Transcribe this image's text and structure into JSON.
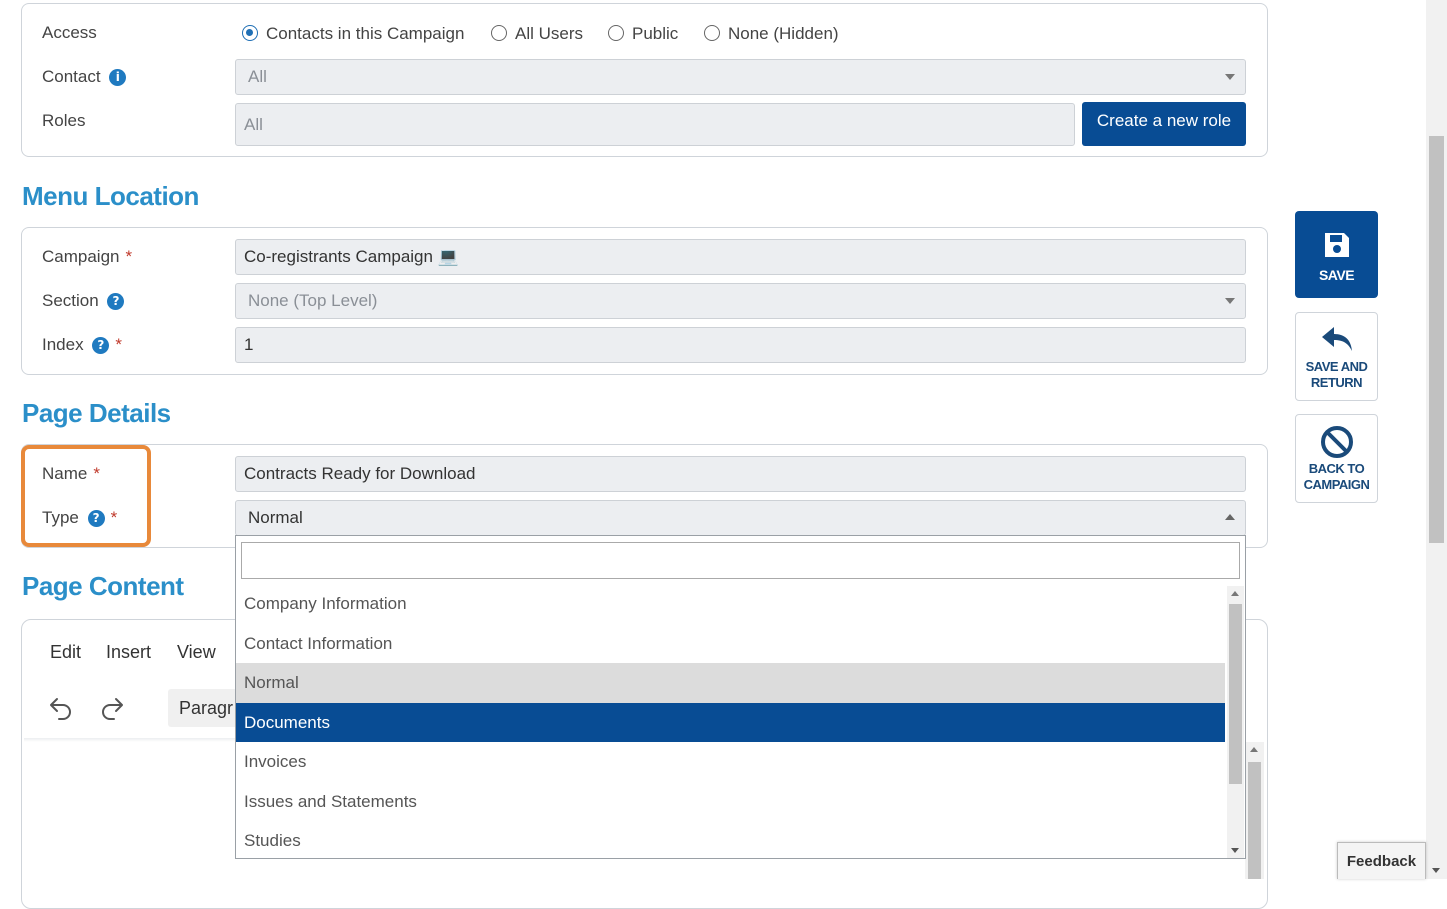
{
  "access": {
    "label": "Access",
    "options": [
      "Contacts in this Campaign",
      "All Users",
      "Public",
      "None (Hidden)"
    ],
    "selected_index": 0,
    "contact_label": "Contact",
    "contact_value": "All",
    "roles_label": "Roles",
    "roles_value": "All",
    "create_role_button": "Create a new role"
  },
  "menu_location": {
    "title": "Menu Location",
    "campaign_label": "Campaign",
    "campaign_value": "Co-registrants Campaign 💻",
    "section_label": "Section",
    "section_value": "None (Top Level)",
    "index_label": "Index",
    "index_value": "1"
  },
  "page_details": {
    "title": "Page Details",
    "name_label": "Name",
    "name_value": "Contracts Ready for Download",
    "type_label": "Type",
    "type_value": "Normal"
  },
  "page_content": {
    "title": "Page Content",
    "menu": [
      "Edit",
      "Insert",
      "View"
    ],
    "paragraph_label": "Paragr"
  },
  "type_dropdown": {
    "search_value": "",
    "options": [
      "Company Information",
      "Contact Information",
      "Normal",
      "Documents",
      "Invoices",
      "Issues and Statements",
      "Studies"
    ],
    "hover_index": 2,
    "selected_index": 3
  },
  "side_actions": {
    "save": "SAVE",
    "save_and_return": "SAVE AND RETURN",
    "back_to_campaign": "BACK TO CAMPAIGN"
  },
  "required_marker": "*",
  "help_marker": "?",
  "info_marker": "i",
  "feedback": "Feedback",
  "colors": {
    "accent": "#2b8fc9",
    "primary": "#084c94",
    "highlight_box": "#e8893a",
    "required": "#c0392b"
  }
}
